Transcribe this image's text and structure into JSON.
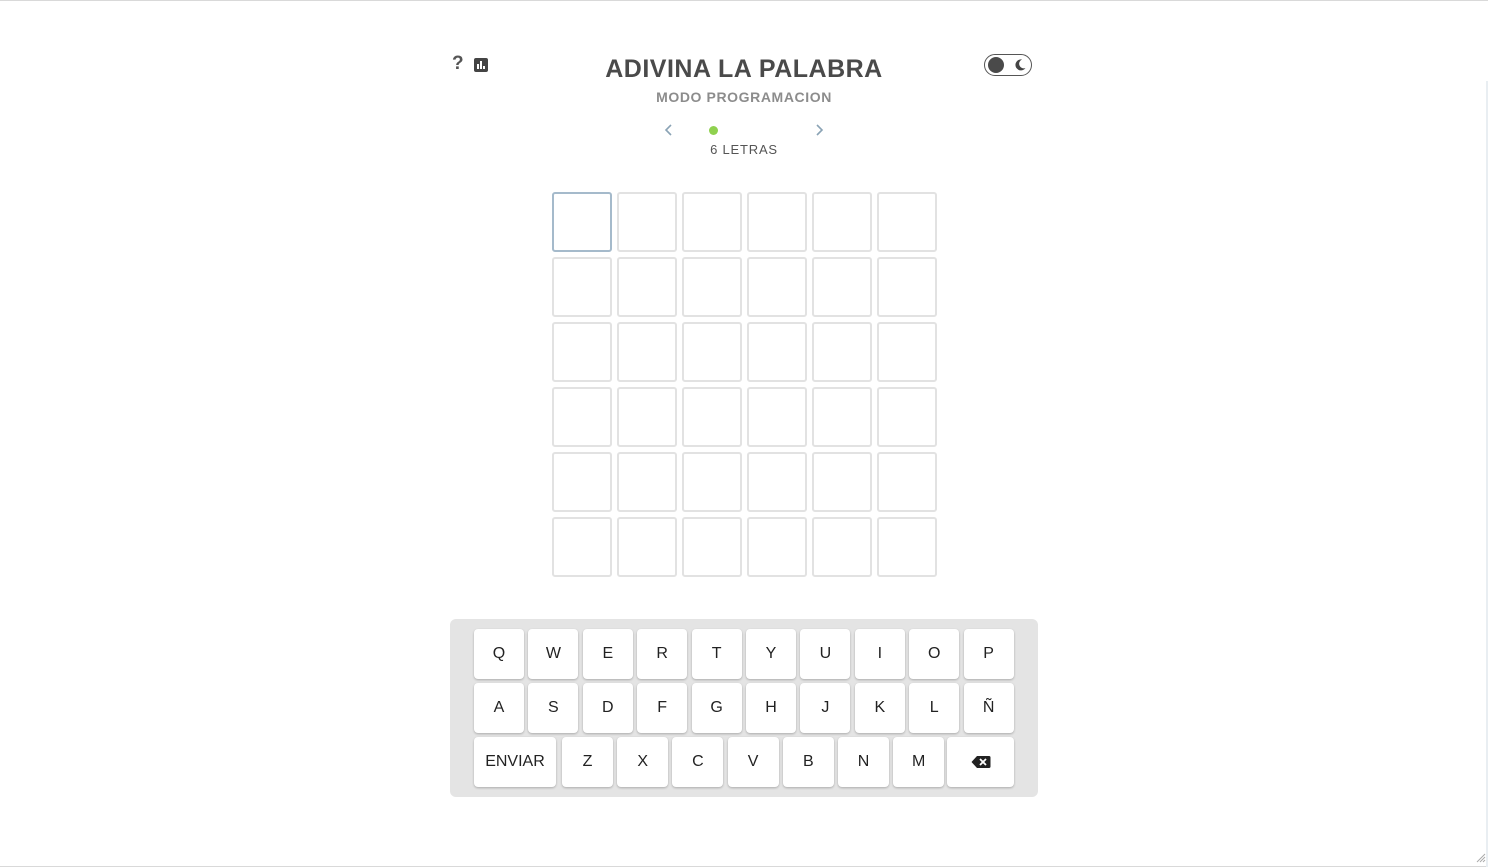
{
  "header": {
    "help_label": "?",
    "stats_icon": "bar-chart-icon",
    "title": "ADIVINA LA PALABRA",
    "subtitle": "MODO PROGRAMACION",
    "theme_icon": "moon-icon"
  },
  "mode_nav": {
    "prev_icon": "chevron-left-icon",
    "next_icon": "chevron-right-icon",
    "dot_color": "#8fd14f",
    "label": "6 LETRAS"
  },
  "board": {
    "rows": 6,
    "cols": 6,
    "active_cell": [
      0,
      0
    ],
    "letters": [
      [
        "",
        "",
        "",
        "",
        "",
        ""
      ],
      [
        "",
        "",
        "",
        "",
        "",
        ""
      ],
      [
        "",
        "",
        "",
        "",
        "",
        ""
      ],
      [
        "",
        "",
        "",
        "",
        "",
        ""
      ],
      [
        "",
        "",
        "",
        "",
        "",
        ""
      ],
      [
        "",
        "",
        "",
        "",
        "",
        ""
      ]
    ]
  },
  "keyboard": {
    "row1": [
      "Q",
      "W",
      "E",
      "R",
      "T",
      "Y",
      "U",
      "I",
      "O",
      "P"
    ],
    "row2": [
      "A",
      "S",
      "D",
      "F",
      "G",
      "H",
      "J",
      "K",
      "L",
      "Ñ"
    ],
    "row3": [
      "ENVIAR",
      "Z",
      "X",
      "C",
      "V",
      "B",
      "N",
      "M"
    ],
    "backspace_icon": "backspace-icon"
  },
  "colors": {
    "title": "#4a4a4a",
    "subtitle": "#8c8c8c",
    "cell_border": "#e2e2e2",
    "active_cell_border": "#a5bacb",
    "keyboard_bg": "#e4e4e4"
  }
}
